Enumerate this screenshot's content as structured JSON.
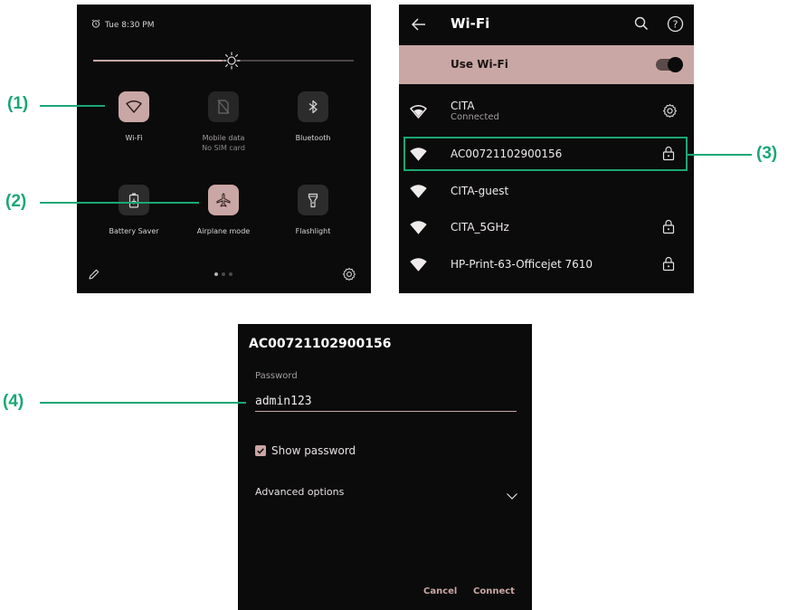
{
  "callouts": {
    "c1": "(1)",
    "c2": "(2)",
    "c3": "(3)",
    "c4": "(4)"
  },
  "quick_settings": {
    "time": "Tue 8:30 PM",
    "brightness": 0.53,
    "tiles": [
      {
        "label": "Wi-Fi",
        "sub": "",
        "icon": "wifi-icon",
        "state": "on"
      },
      {
        "label": "Mobile data",
        "sub": "No SIM card",
        "icon": "mobile-data-icon",
        "state": "unavailable"
      },
      {
        "label": "Bluetooth",
        "sub": "",
        "icon": "bluetooth-icon",
        "state": "off"
      },
      {
        "label": "Battery Saver",
        "sub": "",
        "icon": "battery-icon",
        "state": "off"
      },
      {
        "label": "Airplane mode",
        "sub": "",
        "icon": "airplane-icon",
        "state": "on"
      },
      {
        "label": "Flashlight",
        "sub": "",
        "icon": "flashlight-icon",
        "state": "off"
      }
    ],
    "page_index": 1,
    "page_count": 3
  },
  "wifi": {
    "title": "Wi-Fi",
    "use_wifi_label": "Use Wi-Fi",
    "use_wifi_on": true,
    "networks": [
      {
        "name": "CITA",
        "status": "Connected",
        "locked": false,
        "has_settings": true
      },
      {
        "name": "AC00721102900156",
        "status": "",
        "locked": true,
        "has_settings": false
      },
      {
        "name": "CITA-guest",
        "status": "",
        "locked": false,
        "has_settings": false
      },
      {
        "name": "CITA_5GHz",
        "status": "",
        "locked": true,
        "has_settings": false
      },
      {
        "name": "HP-Print-63-Officejet 7610",
        "status": "",
        "locked": true,
        "has_settings": false
      }
    ]
  },
  "dialog": {
    "title": "AC00721102900156",
    "password_label": "Password",
    "password_value": "admin123",
    "show_password_label": "Show password",
    "show_password_checked": true,
    "advanced_label": "Advanced options",
    "cancel_label": "Cancel",
    "connect_label": "Connect"
  },
  "colors": {
    "accent": "#c9a7a5",
    "callout": "#1aa774",
    "panel_bg": "#0b0b0b"
  }
}
